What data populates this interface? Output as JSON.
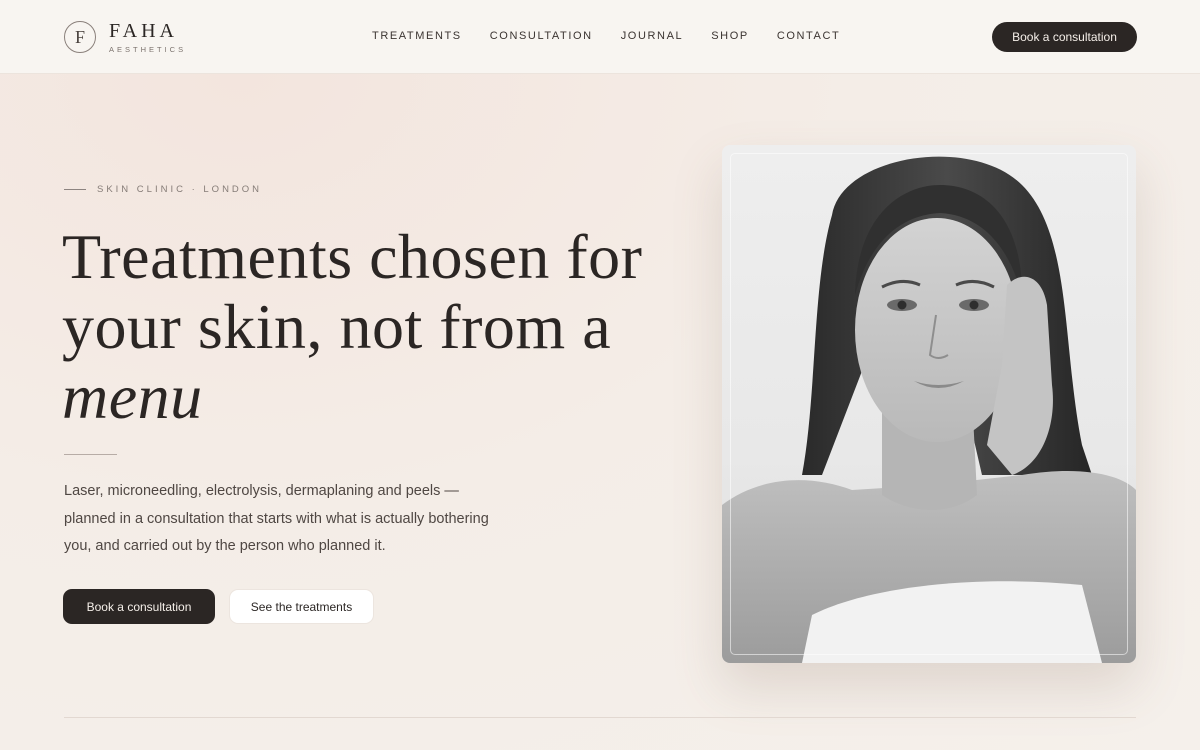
{
  "brand": {
    "monogram": "F",
    "name": "FAHA",
    "tagline": "AESTHETICS"
  },
  "nav": {
    "items": [
      {
        "label": "TREATMENTS"
      },
      {
        "label": "CONSULTATION"
      },
      {
        "label": "JOURNAL"
      },
      {
        "label": "SHOP"
      },
      {
        "label": "CONTACT"
      }
    ],
    "cta_label": "Book a consultation"
  },
  "hero": {
    "eyebrow": "SKIN CLINIC · LONDON",
    "headline_line1": "Treatments chosen for",
    "headline_line2": "your skin, not from a",
    "headline_line3": "menu",
    "description": "Laser, microneedling, electrolysis, dermaplaning and peels — planned in a consultation that starts with what is actually bothering you, and carried out by the person who planned it.",
    "primary_button": "Book a consultation",
    "secondary_button": "See the treatments"
  },
  "portrait": {
    "icon": "portrait-photo"
  },
  "colors": {
    "ink": "#2b2624",
    "background": "#f4ede7",
    "header_bg": "#f8f5f1",
    "muted": "#857c77"
  }
}
